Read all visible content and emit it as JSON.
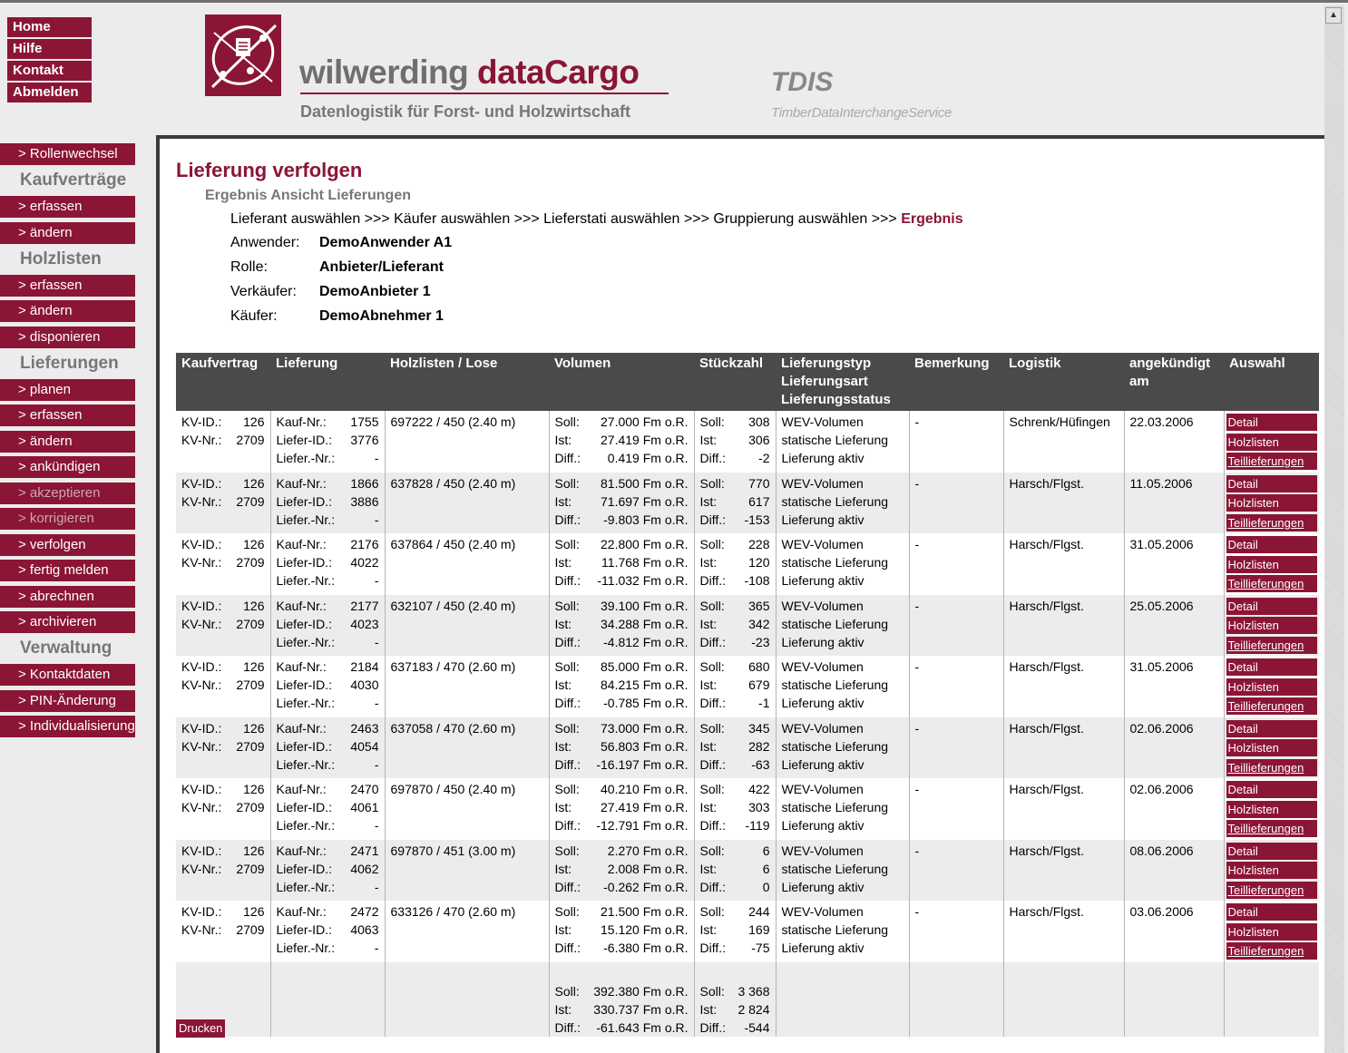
{
  "top_nav": [
    "Home",
    "Hilfe",
    "Kontakt",
    "Abmelden"
  ],
  "brand": {
    "name_part1": "wilwerding ",
    "name_part2": "dataCargo",
    "tagline": "Datenlogistik für Forst- und Holzwirtschaft",
    "tdis": "TDIS",
    "tdis_sub": "TimberDataInterchangeService"
  },
  "side_nav": {
    "rollenwechsel": "> Rollenwechsel",
    "sections": [
      {
        "title": "Kaufverträge",
        "items": [
          {
            "label": "> erfassen",
            "dim": false
          },
          {
            "label": "> ändern",
            "dim": false
          }
        ]
      },
      {
        "title": "Holzlisten",
        "items": [
          {
            "label": "> erfassen",
            "dim": false
          },
          {
            "label": "> ändern",
            "dim": false
          },
          {
            "label": "> disponieren",
            "dim": false
          }
        ]
      },
      {
        "title": "Lieferungen",
        "items": [
          {
            "label": "> planen",
            "dim": false
          },
          {
            "label": "> erfassen",
            "dim": false
          },
          {
            "label": "> ändern",
            "dim": false
          },
          {
            "label": "> ankündigen",
            "dim": false
          },
          {
            "label": "> akzeptieren",
            "dim": true
          },
          {
            "label": "> korrigieren",
            "dim": true
          },
          {
            "label": "> verfolgen",
            "dim": false
          },
          {
            "label": "> fertig melden",
            "dim": false
          },
          {
            "label": "> abrechnen",
            "dim": false
          },
          {
            "label": "> archivieren",
            "dim": false
          }
        ]
      },
      {
        "title": "Verwaltung",
        "items": [
          {
            "label": "> Kontaktdaten",
            "dim": false
          },
          {
            "label": "> PIN-Änderung",
            "dim": false
          },
          {
            "label": "> Individualisierung",
            "dim": false
          }
        ]
      }
    ]
  },
  "page": {
    "title": "Lieferung verfolgen",
    "subtitle": "Ergebnis Ansicht Lieferungen",
    "breadcrumb": "Lieferant auswählen >>> Käufer auswählen >>> Lieferstati auswählen >>> Gruppierung auswählen >>> ",
    "breadcrumb_current": "Ergebnis",
    "info": [
      {
        "label": "Anwender:",
        "value": "DemoAnwender A1"
      },
      {
        "label": "Rolle:",
        "value": "Anbieter/Lieferant"
      },
      {
        "label": "Verkäufer:",
        "value": "DemoAnbieter 1"
      },
      {
        "label": "Käufer:",
        "value": "DemoAbnehmer 1"
      }
    ]
  },
  "table": {
    "headers": [
      "Kaufvertrag",
      "Lieferung",
      "Holzlisten / Lose",
      "Volumen",
      "Stückzahl",
      "Lieferungstyp\nLieferungsart\nLieferungsstatus",
      "Bemerkung",
      "Logistik",
      "angekündigt\nam",
      "Auswahl"
    ],
    "labels": {
      "kv_id": "KV-ID.:",
      "kv_nr": "KV-Nr.:",
      "kauf_nr": "Kauf-Nr.:",
      "liefer_id": "Liefer-ID.:",
      "liefer_nr": "Liefer.-Nr.:",
      "soll": "Soll:",
      "ist": "Ist:",
      "diff": "Diff.:"
    },
    "actions": [
      "Detail",
      "Holzlisten",
      "Teillieferungen"
    ],
    "rows": [
      {
        "kv_id": "126",
        "kv_nr": "2709",
        "kauf_nr": "1755",
        "liefer_id": "3776",
        "liefer_nr": "-",
        "lose": "697222 / 450 (2.40 m)",
        "vol_soll": "27.000 Fm o.R.",
        "vol_ist": "27.419 Fm o.R.",
        "vol_diff": "0.419 Fm o.R.",
        "st_soll": "308",
        "st_ist": "306",
        "st_diff": "-2",
        "typ": "WEV-Volumen",
        "art": "statische Lieferung",
        "status": "Lieferung aktiv",
        "bemerkung": "-",
        "logistik": "Schrenk/Hüfingen",
        "datum": "22.03.2006"
      },
      {
        "kv_id": "126",
        "kv_nr": "2709",
        "kauf_nr": "1866",
        "liefer_id": "3886",
        "liefer_nr": "-",
        "lose": "637828 / 450 (2.40 m)",
        "vol_soll": "81.500 Fm o.R.",
        "vol_ist": "71.697 Fm o.R.",
        "vol_diff": "-9.803 Fm o.R.",
        "st_soll": "770",
        "st_ist": "617",
        "st_diff": "-153",
        "typ": "WEV-Volumen",
        "art": "statische Lieferung",
        "status": "Lieferung aktiv",
        "bemerkung": "-",
        "logistik": "Harsch/Flgst.",
        "datum": "11.05.2006"
      },
      {
        "kv_id": "126",
        "kv_nr": "2709",
        "kauf_nr": "2176",
        "liefer_id": "4022",
        "liefer_nr": "-",
        "lose": "637864 / 450 (2.40 m)",
        "vol_soll": "22.800 Fm o.R.",
        "vol_ist": "11.768 Fm o.R.",
        "vol_diff": "-11.032 Fm o.R.",
        "st_soll": "228",
        "st_ist": "120",
        "st_diff": "-108",
        "typ": "WEV-Volumen",
        "art": "statische Lieferung",
        "status": "Lieferung aktiv",
        "bemerkung": "-",
        "logistik": "Harsch/Flgst.",
        "datum": "31.05.2006"
      },
      {
        "kv_id": "126",
        "kv_nr": "2709",
        "kauf_nr": "2177",
        "liefer_id": "4023",
        "liefer_nr": "-",
        "lose": "632107 / 450 (2.40 m)",
        "vol_soll": "39.100 Fm o.R.",
        "vol_ist": "34.288 Fm o.R.",
        "vol_diff": "-4.812 Fm o.R.",
        "st_soll": "365",
        "st_ist": "342",
        "st_diff": "-23",
        "typ": "WEV-Volumen",
        "art": "statische Lieferung",
        "status": "Lieferung aktiv",
        "bemerkung": "-",
        "logistik": "Harsch/Flgst.",
        "datum": "25.05.2006"
      },
      {
        "kv_id": "126",
        "kv_nr": "2709",
        "kauf_nr": "2184",
        "liefer_id": "4030",
        "liefer_nr": "-",
        "lose": "637183 / 470 (2.60 m)",
        "vol_soll": "85.000 Fm o.R.",
        "vol_ist": "84.215 Fm o.R.",
        "vol_diff": "-0.785 Fm o.R.",
        "st_soll": "680",
        "st_ist": "679",
        "st_diff": "-1",
        "typ": "WEV-Volumen",
        "art": "statische Lieferung",
        "status": "Lieferung aktiv",
        "bemerkung": "-",
        "logistik": "Harsch/Flgst.",
        "datum": "31.05.2006"
      },
      {
        "kv_id": "126",
        "kv_nr": "2709",
        "kauf_nr": "2463",
        "liefer_id": "4054",
        "liefer_nr": "-",
        "lose": "637058 / 470 (2.60 m)",
        "vol_soll": "73.000 Fm o.R.",
        "vol_ist": "56.803 Fm o.R.",
        "vol_diff": "-16.197 Fm o.R.",
        "st_soll": "345",
        "st_ist": "282",
        "st_diff": "-63",
        "typ": "WEV-Volumen",
        "art": "statische Lieferung",
        "status": "Lieferung aktiv",
        "bemerkung": "-",
        "logistik": "Harsch/Flgst.",
        "datum": "02.06.2006"
      },
      {
        "kv_id": "126",
        "kv_nr": "2709",
        "kauf_nr": "2470",
        "liefer_id": "4061",
        "liefer_nr": "-",
        "lose": "697870 / 450 (2.40 m)",
        "vol_soll": "40.210 Fm o.R.",
        "vol_ist": "27.419 Fm o.R.",
        "vol_diff": "-12.791 Fm o.R.",
        "st_soll": "422",
        "st_ist": "303",
        "st_diff": "-119",
        "typ": "WEV-Volumen",
        "art": "statische Lieferung",
        "status": "Lieferung aktiv",
        "bemerkung": "-",
        "logistik": "Harsch/Flgst.",
        "datum": "02.06.2006"
      },
      {
        "kv_id": "126",
        "kv_nr": "2709",
        "kauf_nr": "2471",
        "liefer_id": "4062",
        "liefer_nr": "-",
        "lose": "697870 / 451 (3.00 m)",
        "vol_soll": "2.270 Fm o.R.",
        "vol_ist": "2.008 Fm o.R.",
        "vol_diff": "-0.262 Fm o.R.",
        "st_soll": "6",
        "st_ist": "6",
        "st_diff": "0",
        "typ": "WEV-Volumen",
        "art": "statische Lieferung",
        "status": "Lieferung aktiv",
        "bemerkung": "-",
        "logistik": "Harsch/Flgst.",
        "datum": "08.06.2006"
      },
      {
        "kv_id": "126",
        "kv_nr": "2709",
        "kauf_nr": "2472",
        "liefer_id": "4063",
        "liefer_nr": "-",
        "lose": "633126 / 470 (2.60 m)",
        "vol_soll": "21.500 Fm o.R.",
        "vol_ist": "15.120 Fm o.R.",
        "vol_diff": "-6.380 Fm o.R.",
        "st_soll": "244",
        "st_ist": "169",
        "st_diff": "-75",
        "typ": "WEV-Volumen",
        "art": "statische Lieferung",
        "status": "Lieferung aktiv",
        "bemerkung": "-",
        "logistik": "Harsch/Flgst.",
        "datum": "03.06.2006"
      }
    ],
    "totals": {
      "vol_soll": "392.380 Fm o.R.",
      "vol_ist": "330.737 Fm o.R.",
      "vol_diff": "-61.643 Fm o.R.",
      "st_soll": "3 368",
      "st_ist": "2 824",
      "st_diff": "-544"
    }
  },
  "print_label": "Drucken",
  "colors": {
    "accent": "#8b1535",
    "header_bg": "#4a4a4a",
    "grey_text": "#777777"
  }
}
